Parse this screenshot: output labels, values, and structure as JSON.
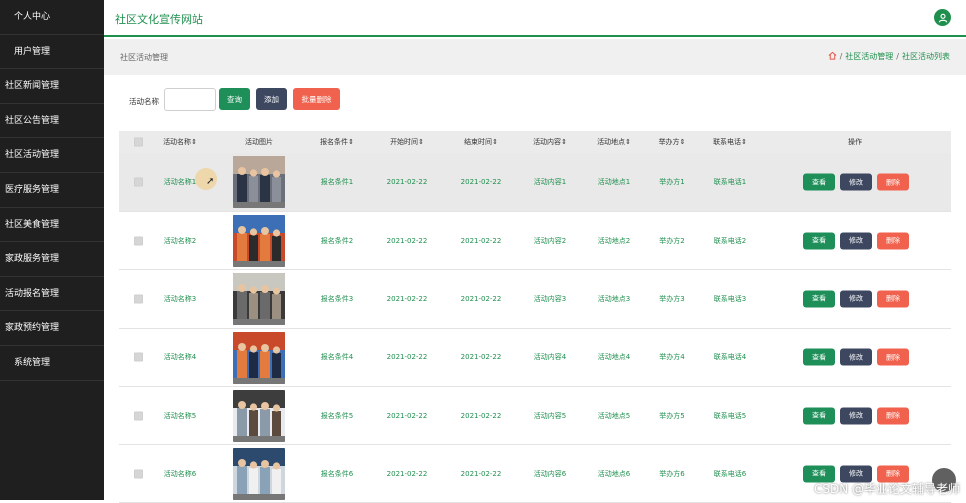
{
  "sidebar": {
    "items": [
      {
        "label": "个人中心",
        "indent": true
      },
      {
        "label": "用户管理",
        "indent": true
      },
      {
        "label": "社区新闻管理",
        "indent": false
      },
      {
        "label": "社区公告管理",
        "indent": false
      },
      {
        "label": "社区活动管理",
        "indent": false
      },
      {
        "label": "医疗服务管理",
        "indent": false
      },
      {
        "label": "社区美食管理",
        "indent": false
      },
      {
        "label": "家政服务管理",
        "indent": false
      },
      {
        "label": "活动报名管理",
        "indent": false
      },
      {
        "label": "家政预约管理",
        "indent": false
      },
      {
        "label": "系统管理",
        "indent": true
      }
    ]
  },
  "header": {
    "site_title": "社区文化宣传网站",
    "user_icon": "user-icon",
    "accent_color": "#1f8f4e"
  },
  "breadcrumb": {
    "page_title": "社区活动管理",
    "home_icon": "home-icon",
    "sep": "/",
    "level1": "社区活动管理",
    "level2": "社区活动列表"
  },
  "search": {
    "label": "活动名称",
    "value": "",
    "query_label": "查询",
    "add_label": "添加",
    "batch_delete_label": "批量删除"
  },
  "table": {
    "columns": {
      "name": "活动名称",
      "image": "活动图片",
      "condition": "报名条件",
      "start": "开始时间",
      "end": "结束时间",
      "content": "活动内容",
      "place": "活动地点",
      "organizer": "举办方",
      "phone": "联系电话",
      "actions": "操作"
    },
    "rows": [
      {
        "name": "活动名称1",
        "condition": "报名条件1",
        "start": "2021-02-22",
        "end": "2021-02-22",
        "content": "活动内容1",
        "place": "活动地点1",
        "organizer": "举办方1",
        "phone": "联系电话1"
      },
      {
        "name": "活动名称2",
        "condition": "报名条件2",
        "start": "2021-02-22",
        "end": "2021-02-22",
        "content": "活动内容2",
        "place": "活动地点2",
        "organizer": "举办方2",
        "phone": "联系电话2"
      },
      {
        "name": "活动名称3",
        "condition": "报名条件3",
        "start": "2021-02-22",
        "end": "2021-02-22",
        "content": "活动内容3",
        "place": "活动地点3",
        "organizer": "举办方3",
        "phone": "联系电话3"
      },
      {
        "name": "活动名称4",
        "condition": "报名条件4",
        "start": "2021-02-22",
        "end": "2021-02-22",
        "content": "活动内容4",
        "place": "活动地点4",
        "organizer": "举办方4",
        "phone": "联系电话4"
      },
      {
        "name": "活动名称5",
        "condition": "报名条件5",
        "start": "2021-02-22",
        "end": "2021-02-22",
        "content": "活动内容5",
        "place": "活动地点5",
        "organizer": "举办方5",
        "phone": "联系电话5"
      },
      {
        "name": "活动名称6",
        "condition": "报名条件6",
        "start": "2021-02-22",
        "end": "2021-02-22",
        "content": "活动内容6",
        "place": "活动地点6",
        "organizer": "举办方6",
        "phone": "联系电话6"
      }
    ],
    "action_labels": {
      "view": "查看",
      "edit": "修改",
      "delete": "删除"
    }
  },
  "watermark": "CSDN @毕业论文辅导老师"
}
